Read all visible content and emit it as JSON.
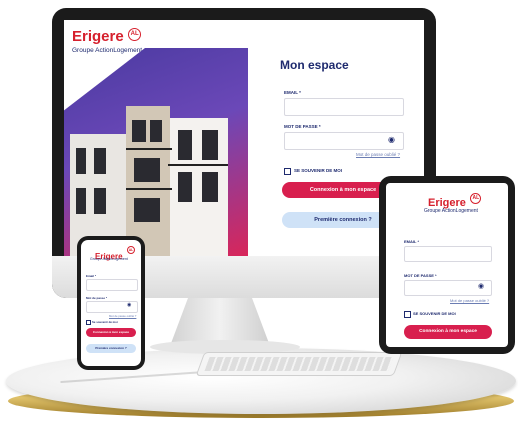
{
  "brand": {
    "name": "Erigere",
    "badge": "AL",
    "group": "Groupe ActionLogement",
    "accent": "#d6202d",
    "navy": "#1e2a6e"
  },
  "desktop": {
    "title": "Mon espace",
    "email_label": "EMAIL *",
    "password_label": "MOT DE PASSE *",
    "forgot_link": "Mot de passe oublié ?",
    "remember_label": "SE SOUVENIR DE MOI",
    "login_button": "Connexion à mon espace",
    "first_login_button": "Première connexion ?"
  },
  "tablet": {
    "email_label": "EMAIL *",
    "password_label": "MOT DE PASSE *",
    "forgot_link": "Mot de passe oublié ?",
    "remember_label": "SE SOUVENIR DE MOI",
    "login_button": "Connexion à mon espace"
  },
  "phone": {
    "email_label": "Email *",
    "password_label": "Mot de passe *",
    "forgot_link": "Mot de passe oublié ?",
    "remember_label": "Se souvenir de moi",
    "login_button": "Connexion à mon espace",
    "first_login_button": "Première connexion ?"
  },
  "colors": {
    "button_red": "#d81f4e",
    "button_blue": "#cfe2f7"
  }
}
